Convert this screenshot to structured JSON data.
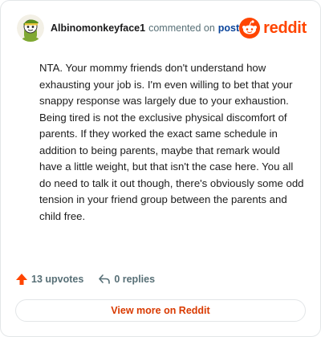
{
  "comment": {
    "username": "Albinomonkeyface1",
    "commented_text": "commented on",
    "post_link": "post",
    "body": "NTA. Your mommy friends don't understand how exhausting your job is. I'm even willing to bet that your snappy response was largely due to your exhaustion. Being tired is not the exclusive physical discomfort of parents. If they worked the exact same schedule in addition to being parents, maybe that remark would have a little weight, but that isn't the case here. You all do need to talk it out though, there's obviously some odd tension in your friend group between the parents and child free.",
    "upvotes": "13 upvotes",
    "replies": "0 replies"
  },
  "brand": {
    "name": "reddit",
    "color": "#ff4500"
  },
  "footer": {
    "view_more": "View more on Reddit"
  },
  "icons": {
    "avatar": "snoo-avatar-icon",
    "logo": "reddit-logo-icon",
    "upvote": "upvote-arrow-icon",
    "reply": "reply-arrow-icon"
  },
  "colors": {
    "link": "#0a449b",
    "upvote": "#ff4500",
    "view_more": "#d93a00"
  }
}
